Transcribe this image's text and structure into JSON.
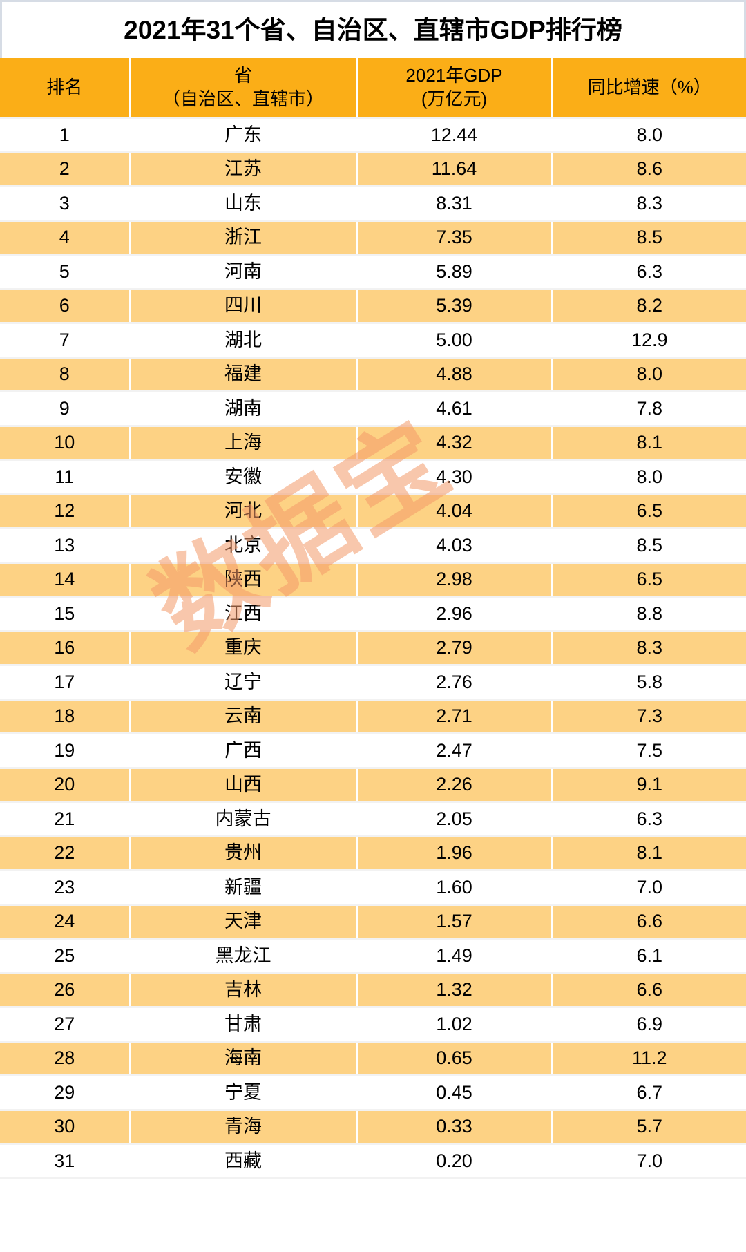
{
  "title": "2021年31个省、自治区、直辖市GDP排行榜",
  "watermark": {
    "text": "数据宝",
    "color": "#f49a6a"
  },
  "theme": {
    "header_bg": "#fbae17",
    "row_alt_bg": "#fdd284",
    "row_bg": "#ffffff",
    "title_border": "#d6dce5",
    "text": "#000000"
  },
  "table": {
    "columns": [
      {
        "key": "rank",
        "line1": "排名",
        "line2": ""
      },
      {
        "key": "prov",
        "line1": "省",
        "line2": "（自治区、直辖市）"
      },
      {
        "key": "gdp",
        "line1": "2021年GDP",
        "line2": "(万亿元)"
      },
      {
        "key": "growth",
        "line1": "同比增速（%）",
        "line2": ""
      }
    ],
    "rows": [
      {
        "rank": "1",
        "province": "广东",
        "gdp": "12.44",
        "growth": "8.0"
      },
      {
        "rank": "2",
        "province": "江苏",
        "gdp": "11.64",
        "growth": "8.6"
      },
      {
        "rank": "3",
        "province": "山东",
        "gdp": "8.31",
        "growth": "8.3"
      },
      {
        "rank": "4",
        "province": "浙江",
        "gdp": "7.35",
        "growth": "8.5"
      },
      {
        "rank": "5",
        "province": "河南",
        "gdp": "5.89",
        "growth": "6.3"
      },
      {
        "rank": "6",
        "province": "四川",
        "gdp": "5.39",
        "growth": "8.2"
      },
      {
        "rank": "7",
        "province": "湖北",
        "gdp": "5.00",
        "growth": "12.9"
      },
      {
        "rank": "8",
        "province": "福建",
        "gdp": "4.88",
        "growth": "8.0"
      },
      {
        "rank": "9",
        "province": "湖南",
        "gdp": "4.61",
        "growth": "7.8"
      },
      {
        "rank": "10",
        "province": "上海",
        "gdp": "4.32",
        "growth": "8.1"
      },
      {
        "rank": "11",
        "province": "安徽",
        "gdp": "4.30",
        "growth": "8.0"
      },
      {
        "rank": "12",
        "province": "河北",
        "gdp": "4.04",
        "growth": "6.5"
      },
      {
        "rank": "13",
        "province": "北京",
        "gdp": "4.03",
        "growth": "8.5"
      },
      {
        "rank": "14",
        "province": "陕西",
        "gdp": "2.98",
        "growth": "6.5"
      },
      {
        "rank": "15",
        "province": "江西",
        "gdp": "2.96",
        "growth": "8.8"
      },
      {
        "rank": "16",
        "province": "重庆",
        "gdp": "2.79",
        "growth": "8.3"
      },
      {
        "rank": "17",
        "province": "辽宁",
        "gdp": "2.76",
        "growth": "5.8"
      },
      {
        "rank": "18",
        "province": "云南",
        "gdp": "2.71",
        "growth": "7.3"
      },
      {
        "rank": "19",
        "province": "广西",
        "gdp": "2.47",
        "growth": "7.5"
      },
      {
        "rank": "20",
        "province": "山西",
        "gdp": "2.26",
        "growth": "9.1"
      },
      {
        "rank": "21",
        "province": "内蒙古",
        "gdp": "2.05",
        "growth": "6.3"
      },
      {
        "rank": "22",
        "province": "贵州",
        "gdp": "1.96",
        "growth": "8.1"
      },
      {
        "rank": "23",
        "province": "新疆",
        "gdp": "1.60",
        "growth": "7.0"
      },
      {
        "rank": "24",
        "province": "天津",
        "gdp": "1.57",
        "growth": "6.6"
      },
      {
        "rank": "25",
        "province": "黑龙江",
        "gdp": "1.49",
        "growth": "6.1"
      },
      {
        "rank": "26",
        "province": "吉林",
        "gdp": "1.32",
        "growth": "6.6"
      },
      {
        "rank": "27",
        "province": "甘肃",
        "gdp": "1.02",
        "growth": "6.9"
      },
      {
        "rank": "28",
        "province": "海南",
        "gdp": "0.65",
        "growth": "11.2"
      },
      {
        "rank": "29",
        "province": "宁夏",
        "gdp": "0.45",
        "growth": "6.7"
      },
      {
        "rank": "30",
        "province": "青海",
        "gdp": "0.33",
        "growth": "5.7"
      },
      {
        "rank": "31",
        "province": "西藏",
        "gdp": "0.20",
        "growth": "7.0"
      }
    ]
  },
  "chart_data": {
    "type": "table",
    "title": "2021年31个省、自治区、直辖市GDP排行榜",
    "columns": [
      "排名",
      "省（自治区、直辖市）",
      "2021年GDP(万亿元)",
      "同比增速（%）"
    ],
    "categories": [
      "广东",
      "江苏",
      "山东",
      "浙江",
      "河南",
      "四川",
      "湖北",
      "福建",
      "湖南",
      "上海",
      "安徽",
      "河北",
      "北京",
      "陕西",
      "江西",
      "重庆",
      "辽宁",
      "云南",
      "广西",
      "山西",
      "内蒙古",
      "贵州",
      "新疆",
      "天津",
      "黑龙江",
      "吉林",
      "甘肃",
      "海南",
      "宁夏",
      "青海",
      "西藏"
    ],
    "series": [
      {
        "name": "2021年GDP(万亿元)",
        "values": [
          12.44,
          11.64,
          8.31,
          7.35,
          5.89,
          5.39,
          5.0,
          4.88,
          4.61,
          4.32,
          4.3,
          4.04,
          4.03,
          2.98,
          2.96,
          2.79,
          2.76,
          2.71,
          2.47,
          2.26,
          2.05,
          1.96,
          1.6,
          1.57,
          1.49,
          1.32,
          1.02,
          0.65,
          0.45,
          0.33,
          0.2
        ]
      },
      {
        "name": "同比增速（%）",
        "values": [
          8.0,
          8.6,
          8.3,
          8.5,
          6.3,
          8.2,
          12.9,
          8.0,
          7.8,
          8.1,
          8.0,
          6.5,
          8.5,
          6.5,
          8.8,
          8.3,
          5.8,
          7.3,
          7.5,
          9.1,
          6.3,
          8.1,
          7.0,
          6.6,
          6.1,
          6.6,
          6.9,
          11.2,
          6.7,
          5.7,
          7.0
        ]
      }
    ],
    "ranks": [
      1,
      2,
      3,
      4,
      5,
      6,
      7,
      8,
      9,
      10,
      11,
      12,
      13,
      14,
      15,
      16,
      17,
      18,
      19,
      20,
      21,
      22,
      23,
      24,
      25,
      26,
      27,
      28,
      29,
      30,
      31
    ],
    "xlabel": "省（自治区、直辖市）",
    "ylabel": "2021年GDP(万亿元)",
    "legend": [
      "2021年GDP(万亿元)",
      "同比增速（%）"
    ],
    "grid": false
  }
}
